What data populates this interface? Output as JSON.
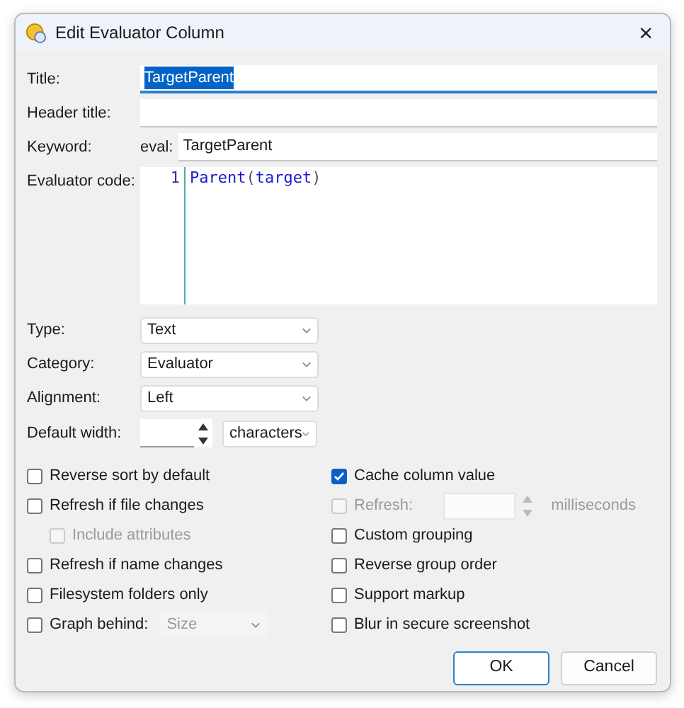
{
  "window": {
    "title": "Edit Evaluator Column",
    "close_glyph": "×"
  },
  "title_field": {
    "label": "Title:",
    "value": "TargetParent",
    "text_selected": true
  },
  "header_title_field": {
    "label": "Header title:"
  },
  "keyword_field": {
    "label": "Keyword:",
    "prefix": "eval:",
    "value": "TargetParent"
  },
  "evaluator_code": {
    "label": "Evaluator code:",
    "lines": [
      {
        "number": "1",
        "tokens": [
          {
            "text": "Parent",
            "kind": "function"
          },
          {
            "text": "(",
            "kind": "punct"
          },
          {
            "text": "target",
            "kind": "identifier"
          },
          {
            "text": ")",
            "kind": "punct"
          }
        ]
      }
    ]
  },
  "dropdowns": [
    {
      "label": "Type:",
      "value": "Text"
    },
    {
      "label": "Category:",
      "value": "Evaluator"
    },
    {
      "label": "Alignment:",
      "value": "Left"
    }
  ],
  "default_width": {
    "label": "Default width:",
    "unit": "characters"
  },
  "left_options": [
    {
      "kind": "checkbox",
      "label": "Reverse sort by default",
      "checked": false,
      "disabled": false
    },
    {
      "kind": "checkbox",
      "label": "Refresh if file changes",
      "checked": false,
      "disabled": false,
      "children": [
        {
          "kind": "checkbox",
          "label": "Include attributes",
          "checked": false,
          "disabled": true
        }
      ]
    },
    {
      "kind": "checkbox",
      "label": "Refresh if name changes",
      "checked": false,
      "disabled": false
    },
    {
      "kind": "checkbox",
      "label": "Filesystem folders only",
      "checked": false,
      "disabled": false
    },
    {
      "kind": "graph",
      "label": "Graph behind:",
      "checked": false,
      "disabled": false,
      "select_value": "Size",
      "select_disabled": true
    }
  ],
  "right_options": [
    {
      "kind": "checkbox",
      "label": "Cache column value",
      "checked": true,
      "disabled": false
    },
    {
      "kind": "interval",
      "label": "Refresh:",
      "checked": false,
      "disabled": true,
      "unit": "milliseconds"
    },
    {
      "kind": "checkbox",
      "label": "Custom grouping",
      "checked": false,
      "disabled": false
    },
    {
      "kind": "checkbox",
      "label": "Reverse group order",
      "checked": false,
      "disabled": false
    },
    {
      "kind": "checkbox",
      "label": "Support markup",
      "checked": false,
      "disabled": false
    },
    {
      "kind": "checkbox",
      "label": "Blur in secure screenshot",
      "checked": false,
      "disabled": false
    }
  ],
  "buttons": [
    {
      "label": "OK",
      "default": true
    },
    {
      "label": "Cancel",
      "default": false
    }
  ]
}
